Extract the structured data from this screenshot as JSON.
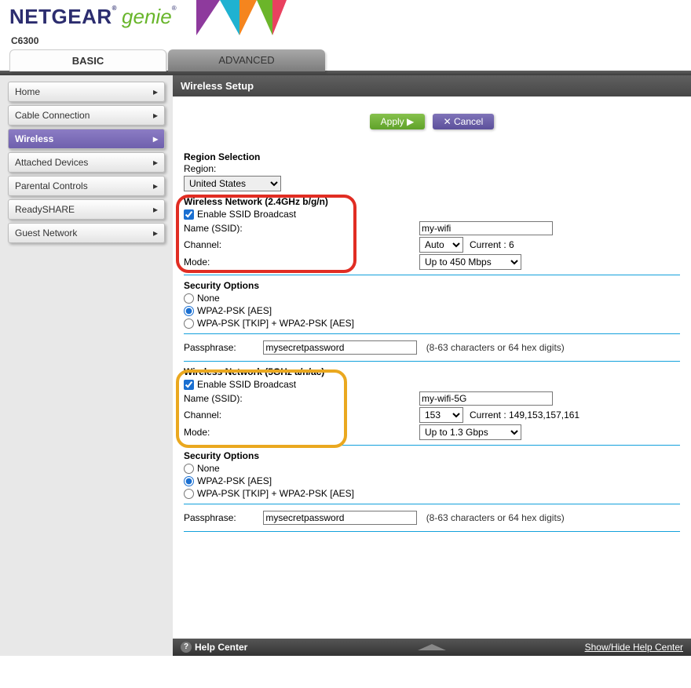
{
  "brand": {
    "name": "NETGEAR",
    "sup": "®",
    "product": "genie",
    "prod_sup": "®"
  },
  "model": "C6300",
  "tabs": {
    "basic": "BASIC",
    "advanced": "ADVANCED"
  },
  "sidebar": {
    "items": [
      {
        "label": "Home"
      },
      {
        "label": "Cable Connection"
      },
      {
        "label": "Wireless"
      },
      {
        "label": "Attached Devices"
      },
      {
        "label": "Parental Controls"
      },
      {
        "label": "ReadySHARE"
      },
      {
        "label": "Guest Network"
      }
    ]
  },
  "page_title": "Wireless Setup",
  "buttons": {
    "apply": "Apply ▶",
    "cancel": "✕ Cancel"
  },
  "region": {
    "head": "Region Selection",
    "label": "Region:",
    "value": "United States"
  },
  "w24": {
    "head": "Wireless Network (2.4GHz b/g/n)",
    "enable": "Enable SSID Broadcast",
    "name_label": "Name (SSID):",
    "name_value": "my-wifi",
    "channel_label": "Channel:",
    "channel_value": "Auto",
    "channel_current": "Current : 6",
    "mode_label": "Mode:",
    "mode_value": "Up to 450 Mbps"
  },
  "sec24": {
    "head": "Security Options",
    "none": "None",
    "wpa2": "WPA2-PSK [AES]",
    "mixed": "WPA-PSK [TKIP] + WPA2-PSK [AES]",
    "pass_label": "Passphrase:",
    "pass_value": "mysecretpassword",
    "pass_hint": "(8-63 characters or 64 hex digits)"
  },
  "w5": {
    "head": "Wireless Network (5GHz a/n/ac)",
    "enable": "Enable SSID Broadcast",
    "name_label": "Name (SSID):",
    "name_value": "my-wifi-5G",
    "channel_label": "Channel:",
    "channel_value": "153",
    "channel_current": "Current : 149,153,157,161",
    "mode_label": "Mode:",
    "mode_value": "Up to 1.3 Gbps"
  },
  "sec5": {
    "head": "Security Options",
    "none": "None",
    "wpa2": "WPA2-PSK [AES]",
    "mixed": "WPA-PSK [TKIP] + WPA2-PSK [AES]",
    "pass_label": "Passphrase:",
    "pass_value": "mysecretpassword",
    "pass_hint": "(8-63 characters or 64 hex digits)"
  },
  "footer": {
    "help": "Help Center",
    "toggle": "Show/Hide Help Center"
  }
}
